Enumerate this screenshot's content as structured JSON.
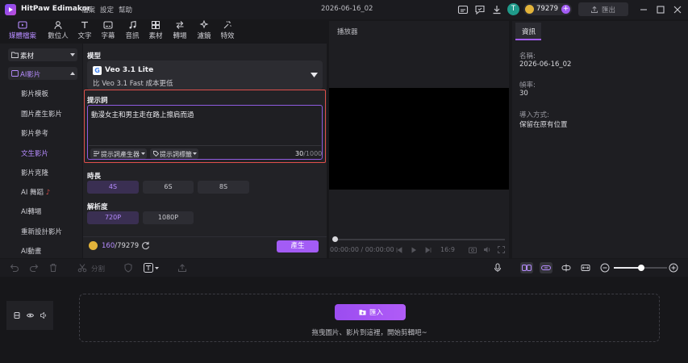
{
  "app": {
    "name": "HitPaw Edimakor",
    "project_title": "2026-06-16_02",
    "credits": "79279",
    "export_label": "匯出"
  },
  "menu": {
    "file": "檔案",
    "settings": "設定",
    "help": "幫助"
  },
  "avatar_letter": "T",
  "tools": [
    {
      "label": "媒體檔案"
    },
    {
      "label": "數位人"
    },
    {
      "label": "文字"
    },
    {
      "label": "字幕"
    },
    {
      "label": "音訊"
    },
    {
      "label": "素材"
    },
    {
      "label": "轉場"
    },
    {
      "label": "濾鏡"
    },
    {
      "label": "特效"
    }
  ],
  "sidebar": {
    "group1": "素材",
    "group2": "AI影片",
    "items": [
      {
        "label": "影片模板"
      },
      {
        "label": "圖片產生影片"
      },
      {
        "label": "影片參考"
      },
      {
        "label": "文生影片"
      },
      {
        "label": "影片克隆"
      },
      {
        "label": "AI 舞蹈"
      },
      {
        "label": "AI轉場"
      },
      {
        "label": "重新設計影片"
      },
      {
        "label": "AI動畫"
      }
    ]
  },
  "settings": {
    "model_label": "模型",
    "model_name": "Veo 3.1 Lite",
    "model_desc": "比 Veo 3.1 Fast 成本更低",
    "prompt_label": "提示詞",
    "prompt_text": "動漫女主和男主走在路上擦肩而過",
    "prompt_gen": "提示詞產生器",
    "prompt_tags": "提示詞標籤",
    "char_count": "30",
    "char_max": "/1000",
    "duration_label": "時長",
    "durations": [
      "4S",
      "6S",
      "8S"
    ],
    "resolution_label": "解析度",
    "resolutions": [
      "720P",
      "1080P"
    ],
    "cost": "160",
    "cost_total": "/79279",
    "generate_label": "產生"
  },
  "player": {
    "title": "播放器",
    "time_current": "00:00:00",
    "time_total": "00:00:00",
    "ratio": "16:9"
  },
  "info": {
    "tab": "資訊",
    "name_label": "名稱:",
    "name_value": "2026-06-16_02",
    "fps_label": "幀率:",
    "fps_value": "30",
    "import_label": "導入方式:",
    "import_value": "保留在原有位置"
  },
  "timeline": {
    "split_label": "分割",
    "import_label": "匯入",
    "hint": "拖曳圖片、影片到這裡，開始剪輯吧~"
  },
  "colors": {
    "accent": "#a35cf5",
    "highlight_border": "#e0504b"
  }
}
